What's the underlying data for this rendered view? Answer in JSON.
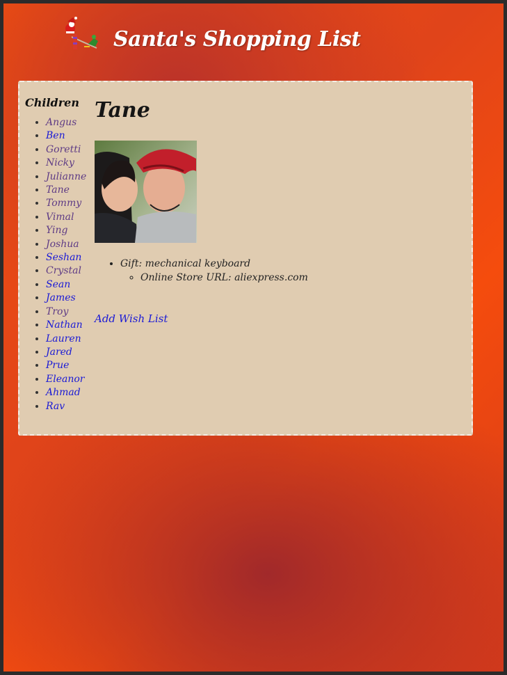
{
  "header": {
    "title": "Santa's Shopping List",
    "logo_icon": "santa-sleigh-icon"
  },
  "sidebar": {
    "title": "Children",
    "children": [
      {
        "name": "Angus",
        "visited": true
      },
      {
        "name": "Ben",
        "visited": false
      },
      {
        "name": "Goretti",
        "visited": true
      },
      {
        "name": "Nicky",
        "visited": true
      },
      {
        "name": "Julianne",
        "visited": true
      },
      {
        "name": "Tane",
        "visited": true
      },
      {
        "name": "Tommy",
        "visited": true
      },
      {
        "name": "Vimal",
        "visited": true
      },
      {
        "name": "Ying",
        "visited": true
      },
      {
        "name": "Joshua",
        "visited": true
      },
      {
        "name": "Seshan",
        "visited": false
      },
      {
        "name": "Crystal",
        "visited": true
      },
      {
        "name": "Sean",
        "visited": false
      },
      {
        "name": "James",
        "visited": false
      },
      {
        "name": "Troy",
        "visited": true
      },
      {
        "name": "Nathan",
        "visited": false
      },
      {
        "name": "Lauren",
        "visited": false
      },
      {
        "name": "Jared",
        "visited": false
      },
      {
        "name": "Prue",
        "visited": false
      },
      {
        "name": "Eleanor",
        "visited": false
      },
      {
        "name": "Ahmad",
        "visited": false
      },
      {
        "name": "Rav",
        "visited": false
      }
    ]
  },
  "main": {
    "child_name": "Tane",
    "gift": {
      "label": "Gift: mechanical keyboard",
      "store_label": "Online Store URL: aliexpress.com"
    },
    "add_wish_list": "Add Wish List"
  },
  "colors": {
    "link": "#1a1ad6",
    "visited_link": "#5e3b85",
    "panel_bg": "#e0ccb1",
    "page_accent": "#f2500f"
  }
}
